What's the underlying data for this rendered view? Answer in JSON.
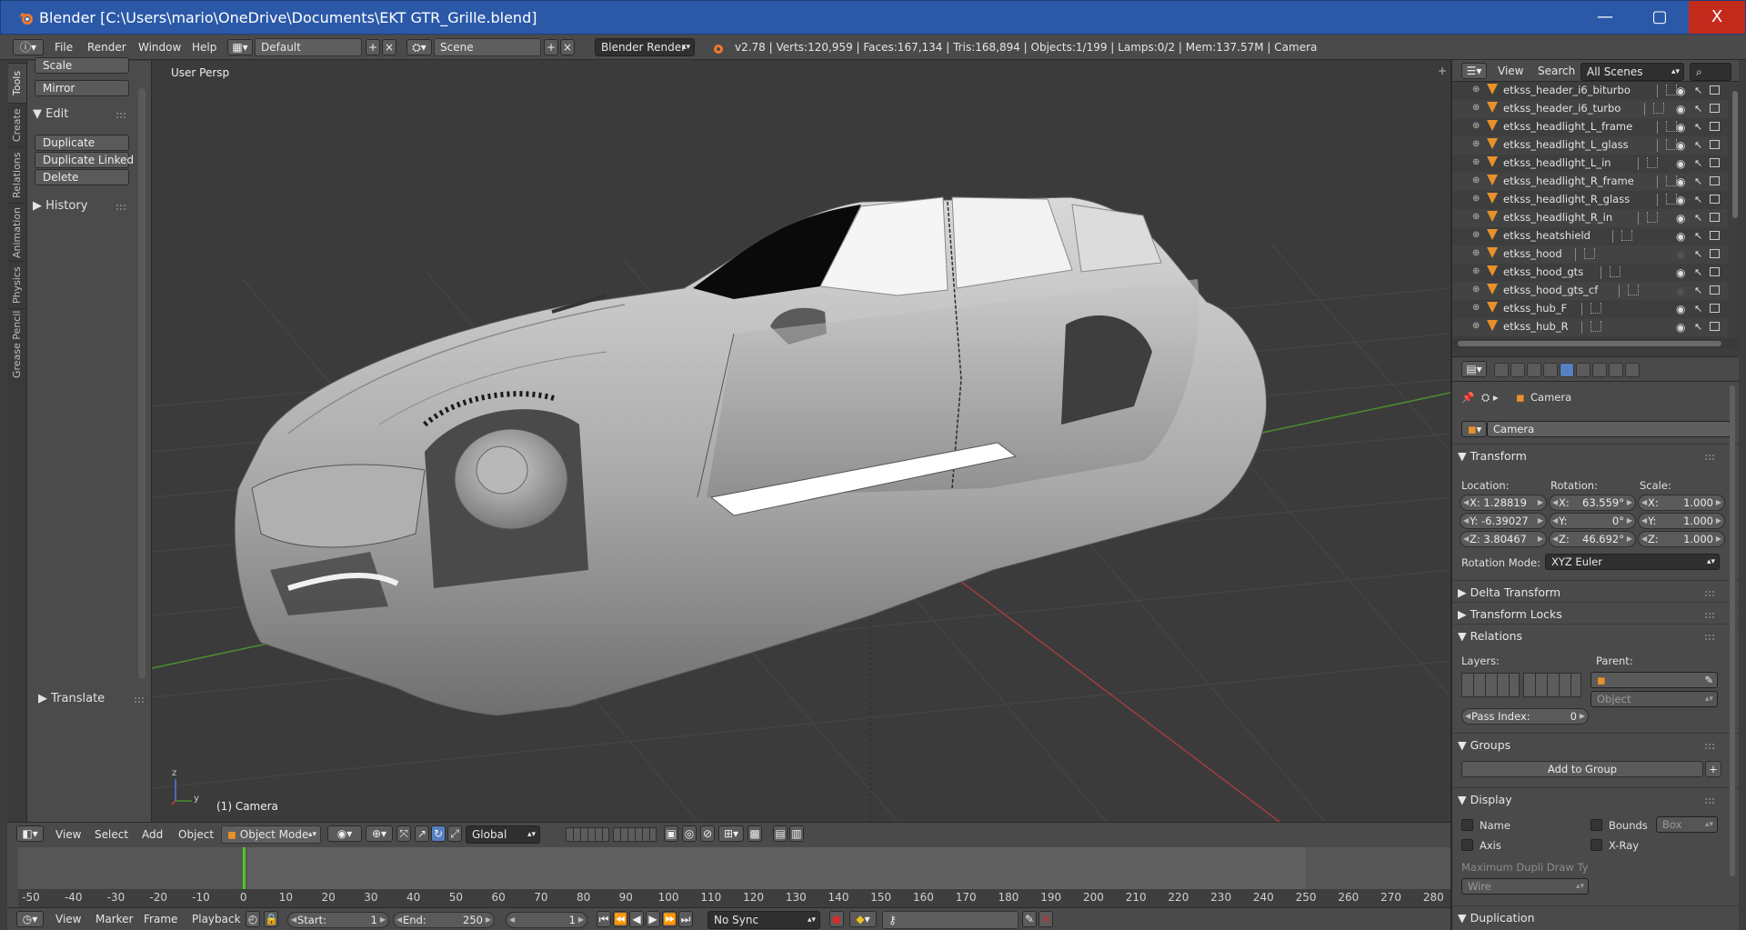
{
  "window": {
    "title": "Blender [C:\\Users\\mario\\OneDrive\\Documents\\EKT GTR_Grille.blend]",
    "minimize": "—",
    "maximize": "▢",
    "close": "X"
  },
  "infobar": {
    "menus": [
      "File",
      "Render",
      "Window",
      "Help"
    ],
    "screen_layout": "Default",
    "scene": "Scene",
    "render_engine": "Blender Render",
    "stats": "v2.78 | Verts:120,959 | Faces:167,134 | Tris:168,894 | Objects:1/199 | Lamps:0/2 | Mem:137.57M | Camera"
  },
  "tool_tabs": [
    "Tools",
    "Create",
    "Relations",
    "Animation",
    "Physics",
    "Grease Pencil"
  ],
  "tool_shelf": {
    "scale_label": "Scale",
    "mirror_label": "Mirror",
    "edit_header": "Edit",
    "edit_buttons": [
      "Duplicate",
      "Duplicate Linked",
      "Delete"
    ],
    "history_header": "History",
    "translate_header": "Translate"
  },
  "viewport": {
    "view_name": "User Persp",
    "active_object": "(1) Camera",
    "axis_z": "z",
    "axis_y": "y"
  },
  "viewport_header": {
    "menus": [
      "View",
      "Select",
      "Add",
      "Object"
    ],
    "mode": "Object Mode",
    "orientation": "Global"
  },
  "timeline": {
    "ticks": [
      -50,
      -40,
      -30,
      -20,
      -10,
      0,
      10,
      20,
      30,
      40,
      50,
      60,
      70,
      80,
      90,
      100,
      110,
      120,
      130,
      140,
      150,
      160,
      170,
      180,
      190,
      200,
      210,
      220,
      230,
      240,
      250,
      260,
      270,
      280
    ],
    "range_min": -53,
    "range_max": 284,
    "current_frame_value": 0,
    "menus": [
      "View",
      "Marker",
      "Frame",
      "Playback"
    ],
    "start_label": "Start:",
    "start": "1",
    "end_label": "End:",
    "end": "250",
    "current_frame": "1",
    "sync": "No Sync"
  },
  "outliner": {
    "menus": [
      "View",
      "Search"
    ],
    "filter": "All Scenes",
    "items": [
      {
        "name": "etkss_header_i6_biturbo",
        "visible": true
      },
      {
        "name": "etkss_header_i6_turbo",
        "visible": true
      },
      {
        "name": "etkss_headlight_L_frame",
        "visible": true
      },
      {
        "name": "etkss_headlight_L_glass",
        "visible": true
      },
      {
        "name": "etkss_headlight_L_in",
        "visible": true
      },
      {
        "name": "etkss_headlight_R_frame",
        "visible": true
      },
      {
        "name": "etkss_headlight_R_glass",
        "visible": true
      },
      {
        "name": "etkss_headlight_R_in",
        "visible": true
      },
      {
        "name": "etkss_heatshield",
        "visible": true
      },
      {
        "name": "etkss_hood",
        "visible": false
      },
      {
        "name": "etkss_hood_gts",
        "visible": true
      },
      {
        "name": "etkss_hood_gts_cf",
        "visible": false
      },
      {
        "name": "etkss_hub_F",
        "visible": true
      },
      {
        "name": "etkss_hub_R",
        "visible": true
      }
    ]
  },
  "properties": {
    "breadcrumb": "Camera",
    "object_name": "Camera",
    "transform_header": "Transform",
    "location_label": "Location:",
    "rotation_label": "Rotation:",
    "scale_label": "Scale:",
    "location": [
      "X: 1.28819",
      "Y: -6.39027",
      "Z: 3.80467"
    ],
    "rotation": [
      {
        "axis": "X:",
        "val": "63.559°"
      },
      {
        "axis": "Y:",
        "val": "0°"
      },
      {
        "axis": "Z:",
        "val": "46.692°"
      }
    ],
    "scale": [
      {
        "axis": "X:",
        "val": "1.000"
      },
      {
        "axis": "Y:",
        "val": "1.000"
      },
      {
        "axis": "Z:",
        "val": "1.000"
      }
    ],
    "rotation_mode_label": "Rotation Mode:",
    "rotation_mode": "XYZ Euler",
    "delta_transform": "Delta Transform",
    "transform_locks": "Transform Locks",
    "relations_header": "Relations",
    "layers_label": "Layers:",
    "parent_label": "Parent:",
    "parent_type": "Object",
    "pass_index_label": "Pass Index:",
    "pass_index": "0",
    "groups_header": "Groups",
    "add_to_group": "Add to Group",
    "display_header": "Display",
    "display_name": "Name",
    "display_bounds": "Bounds",
    "bounds_type": "Box",
    "display_axis": "Axis",
    "display_xray": "X-Ray",
    "max_dupli_label": "Maximum Dupli Draw Ty",
    "max_dupli_value": "Wire",
    "duplication_header": "Duplication"
  },
  "colors": {
    "titlebar": "#2b59a8",
    "close_button": "#c42b1c",
    "viewport_bg": "#3b3b3b",
    "x_axis": "#a23d3d",
    "y_axis": "#4a8f2e",
    "frame_cursor": "#4cc82a",
    "object_icon": "#e8912a",
    "selected_tab": "#5680c2"
  }
}
